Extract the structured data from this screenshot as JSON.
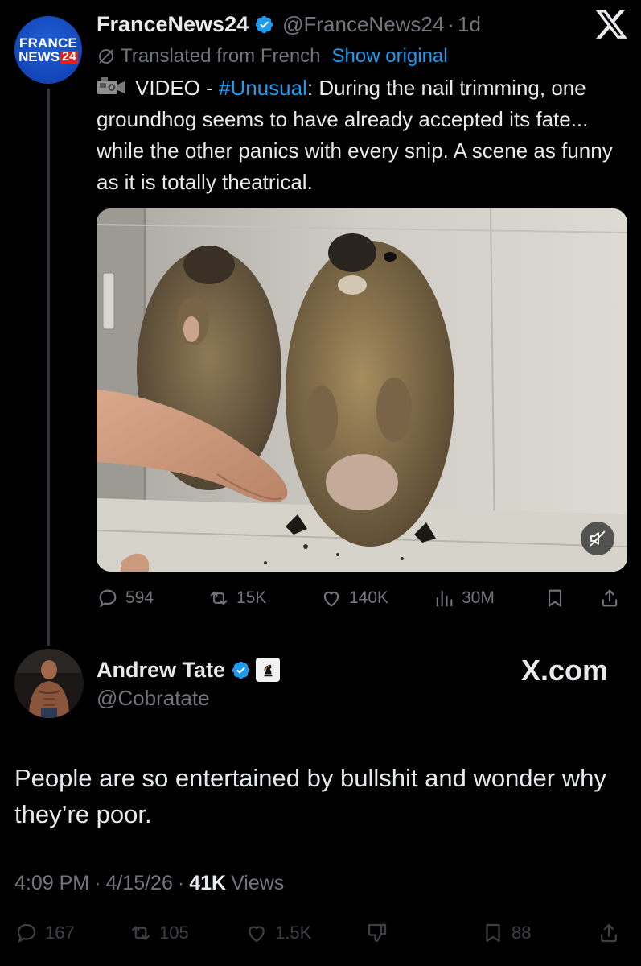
{
  "original_tweet": {
    "avatar_line1": "FRANCE",
    "avatar_line2_text": "NEWS",
    "avatar_line2_num": "24",
    "display_name": "FranceNews24",
    "handle": "@FranceNews24",
    "separator": "·",
    "age": "1d",
    "translated_label": "Translated from French",
    "show_original": "Show original",
    "text_prefix": "VIDEO - ",
    "hashtag": "#Unusual",
    "text_rest": ": During the nail trimming, one groundhog seems to have already accepted its fate... while the other panics with every snip. A scene as funny as it is totally theatrical.",
    "actions": {
      "replies": "594",
      "reposts": "15K",
      "likes": "140K",
      "views": "30M"
    }
  },
  "reply_tweet": {
    "display_name": "Andrew Tate",
    "handle": "@Cobratate",
    "watermark": "X.com",
    "text": "People are so entertained by bullshit and wonder why they’re poor.",
    "time": "4:09 PM",
    "date": "4/15/26",
    "views_count": "41K",
    "views_label": "Views",
    "actions": {
      "replies": "167",
      "reposts": "105",
      "likes": "1.5K",
      "bookmarks": "88"
    }
  },
  "icons": {
    "verified": "verified-badge-icon",
    "x_logo": "x-logo-icon",
    "translate": "globe-icon",
    "camera": "video-camera-icon",
    "mute": "muted-speaker-icon",
    "reply": "reply-icon",
    "repost": "repost-icon",
    "like": "heart-icon",
    "views": "views-bar-icon",
    "bookmark": "bookmark-icon",
    "share": "share-icon",
    "dislike": "thumbs-down-icon",
    "chess": "chess-knight-icon"
  },
  "colors": {
    "background": "#000000",
    "text": "#e7e9ea",
    "muted": "#71767b",
    "accent": "#1d9bf0",
    "news_red": "#e2231a",
    "news_blue": "#1346b8"
  }
}
